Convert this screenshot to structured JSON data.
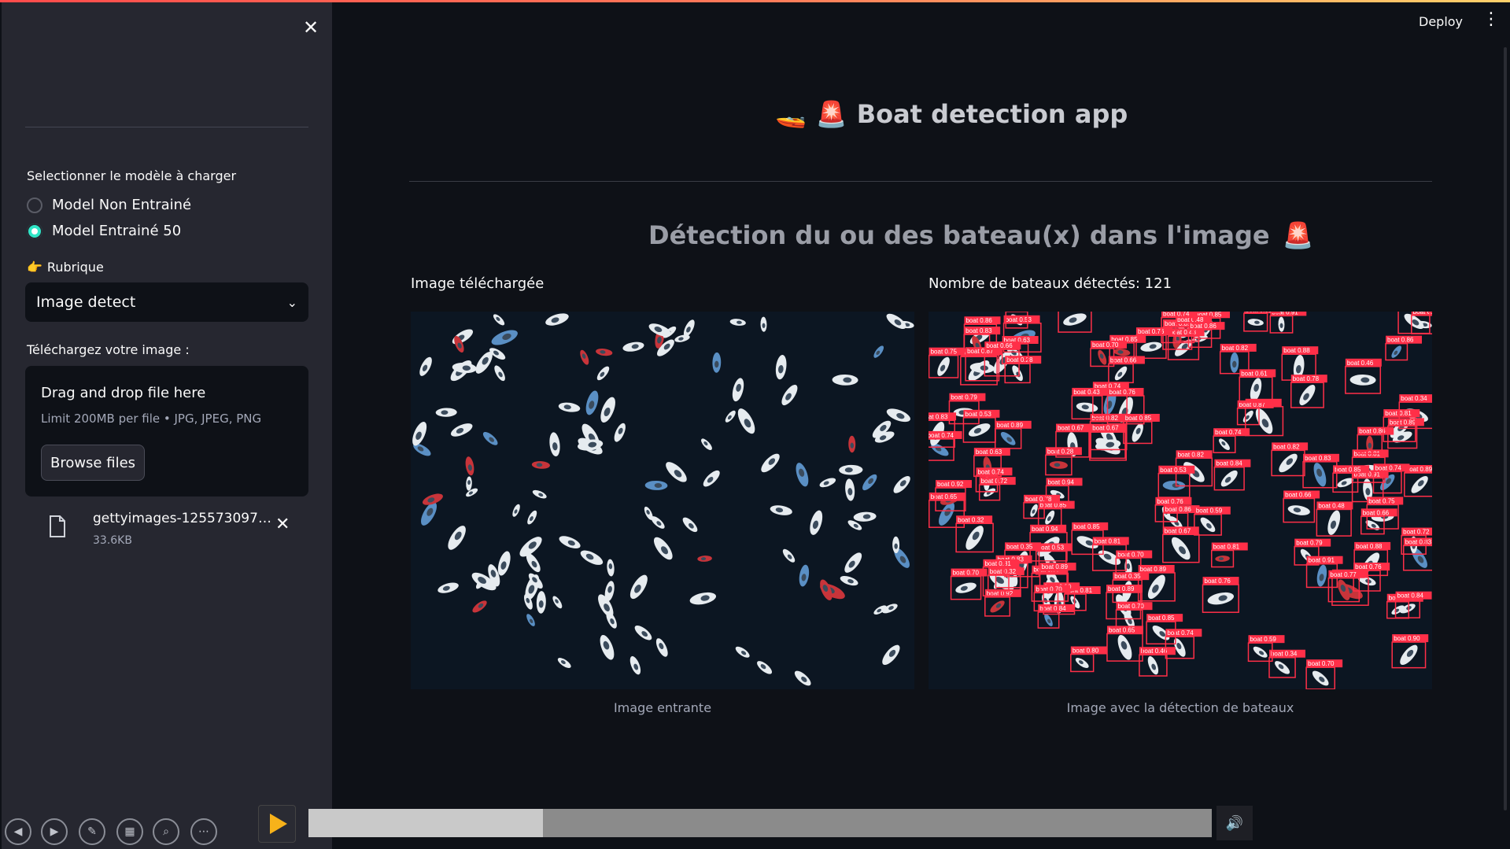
{
  "sidebar": {
    "close_icon": "close-icon",
    "model_label": "Selectionner le modèle à charger",
    "models": [
      {
        "label": "Model Non Entrainé",
        "selected": false
      },
      {
        "label": "Model Entrainé 50",
        "selected": true
      }
    ],
    "rubrique_emoji": "👉",
    "rubrique_label": "Rubrique",
    "rubrique_value": "Image detect",
    "upload_label": "Téléchargez votre image :",
    "dropzone": {
      "title": "Drag and drop file here",
      "limit": "Limit 200MB per file • JPG, JPEG, PNG",
      "browse_label": "Browse files"
    },
    "file": {
      "name": "gettyimages-1255730974...",
      "size": "33.6KB"
    }
  },
  "header": {
    "deploy_label": "Deploy",
    "menu_icon": "kebab-menu-icon"
  },
  "main": {
    "title_emoji_1": "🚤",
    "title_emoji_2": "🚨",
    "title": "Boat detection app",
    "subtitle": "Détection du ou des bateau(x) dans l'image",
    "subtitle_emoji": "🚨",
    "left_header": "Image téléchargée",
    "right_header": "Nombre de bateaux détectés: 121",
    "left_caption": "Image entrante",
    "right_caption": "Image avec la détection de bateaux",
    "detection_labels": [
      "boat 0.86",
      "boat 0.43",
      "boat 0.81",
      "boat 0.53",
      "boat 0.53",
      "boat 0.46",
      "boat 0.6",
      "boat 0.85",
      "boat 0.80",
      "boat 0.91",
      "boat 0.79",
      "boat 0.86",
      "boat 0.89",
      "boat 0.85",
      "boat 0.88",
      "boat 0.90",
      "boat 0.85",
      "boat 0.70",
      "boat 0.74",
      "boat 0.89",
      "boat 0.92",
      "boat 0.83",
      "boat 0.84",
      "boat 0.65",
      "boat 0.89",
      "boat 0.74",
      "boat 0.85",
      "boat 0.72",
      "boat 0.89",
      "boat 0.87",
      "boat 0.83",
      "boat 0.84",
      "boat 0.82",
      "boat 0.74",
      "boat 0.81",
      "boat 0.75",
      "boat 0.76",
      "boat 0.35",
      "boat 0.76",
      "boat 0.83",
      "boat 0.78",
      "boat 0.48",
      "boat 0.77",
      "boat 0.70",
      "boat 0.66",
      "boat 0.28",
      "boat 0.70",
      "boat 0.63",
      "boat 0.32",
      "boat 0.67",
      "boat 0.94",
      "boat 0.61",
      "boat 0.81",
      "boat 0.82",
      "boat 0.91",
      "boat 0.34",
      "boat 0.59",
      "boat 0.66",
      "boat 0.76",
      "boat 0.74",
      "boat 0.86",
      "boat 0.67"
    ]
  },
  "player": {
    "progress": 0.26,
    "controls": [
      "back-icon",
      "forward-icon",
      "pen-icon",
      "layout-icon",
      "zoom-icon",
      "more-icon"
    ]
  }
}
